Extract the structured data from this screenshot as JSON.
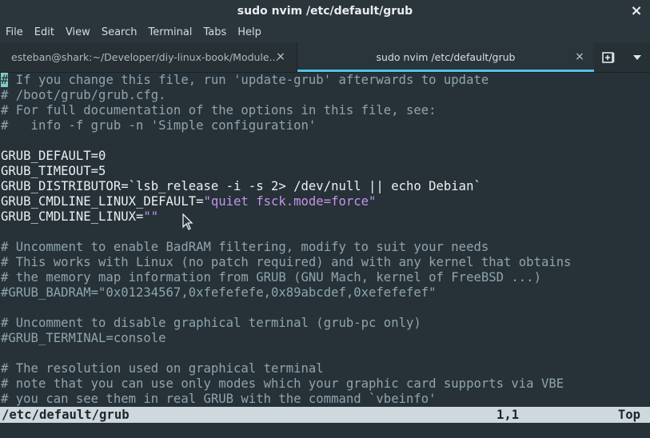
{
  "window": {
    "title": "sudo nvim /etc/default/grub"
  },
  "menu": [
    "File",
    "Edit",
    "View",
    "Search",
    "Terminal",
    "Tabs",
    "Help"
  ],
  "tabs": [
    {
      "label": "esteban@shark:~/Developer/diy-linux-book/Module...",
      "active": false
    },
    {
      "label": "sudo nvim /etc/default/grub",
      "active": true
    }
  ],
  "editor": {
    "lines": [
      {
        "segments": [
          {
            "text": "#",
            "type": "cursor"
          },
          {
            "text": " If you change this file, run 'update-grub' afterwards to update",
            "type": "comment"
          }
        ]
      },
      {
        "segments": [
          {
            "text": "# /boot/grub/grub.cfg.",
            "type": "comment"
          }
        ]
      },
      {
        "segments": [
          {
            "text": "# For full documentation of the options in this file, see:",
            "type": "comment"
          }
        ]
      },
      {
        "segments": [
          {
            "text": "#   info -f grub -n 'Simple configuration'",
            "type": "comment"
          }
        ]
      },
      {
        "segments": [
          {
            "text": "",
            "type": "plain"
          }
        ]
      },
      {
        "segments": [
          {
            "text": "GRUB_DEFAULT=0",
            "type": "plain"
          }
        ]
      },
      {
        "segments": [
          {
            "text": "GRUB_TIMEOUT=5",
            "type": "plain"
          }
        ]
      },
      {
        "segments": [
          {
            "text": "GRUB_DISTRIBUTOR=`lsb_release -i -s 2> /dev/null || echo Debian`",
            "type": "plain"
          }
        ]
      },
      {
        "segments": [
          {
            "text": "GRUB_CMDLINE_LINUX_DEFAULT=",
            "type": "plain"
          },
          {
            "text": "\"quiet fsck.mode=force\"",
            "type": "string"
          }
        ]
      },
      {
        "segments": [
          {
            "text": "GRUB_CMDLINE_LINUX=",
            "type": "plain"
          },
          {
            "text": "\"\"",
            "type": "string"
          }
        ]
      },
      {
        "segments": [
          {
            "text": "",
            "type": "plain"
          }
        ]
      },
      {
        "segments": [
          {
            "text": "# Uncomment to enable BadRAM filtering, modify to suit your needs",
            "type": "comment"
          }
        ]
      },
      {
        "segments": [
          {
            "text": "# This works with Linux (no patch required) and with any kernel that obtains",
            "type": "comment"
          }
        ]
      },
      {
        "segments": [
          {
            "text": "# the memory map information from GRUB (GNU Mach, kernel of FreeBSD ...)",
            "type": "comment"
          }
        ]
      },
      {
        "segments": [
          {
            "text": "#GRUB_BADRAM=\"0x01234567,0xfefefefe,0x89abcdef,0xefefefef\"",
            "type": "comment"
          }
        ]
      },
      {
        "segments": [
          {
            "text": "",
            "type": "plain"
          }
        ]
      },
      {
        "segments": [
          {
            "text": "# Uncomment to disable graphical terminal (grub-pc only)",
            "type": "comment"
          }
        ]
      },
      {
        "segments": [
          {
            "text": "#GRUB_TERMINAL=console",
            "type": "comment"
          }
        ]
      },
      {
        "segments": [
          {
            "text": "",
            "type": "plain"
          }
        ]
      },
      {
        "segments": [
          {
            "text": "# The resolution used on graphical terminal",
            "type": "comment"
          }
        ]
      },
      {
        "segments": [
          {
            "text": "# note that you can use only modes which your graphic card supports via VBE",
            "type": "comment"
          }
        ]
      },
      {
        "segments": [
          {
            "text": "# you can see them in real GRUB with the command `vbeinfo'",
            "type": "comment"
          }
        ]
      }
    ]
  },
  "statusline": {
    "file": "/etc/default/grub",
    "position": "1,1",
    "scroll": "Top"
  },
  "icons": {
    "close": "×",
    "chevron": "▾"
  },
  "colors": {
    "accent": "#4fc1e9",
    "comment": "#90a4ae",
    "string": "#c792ea",
    "cursor": "#80cbc4"
  }
}
